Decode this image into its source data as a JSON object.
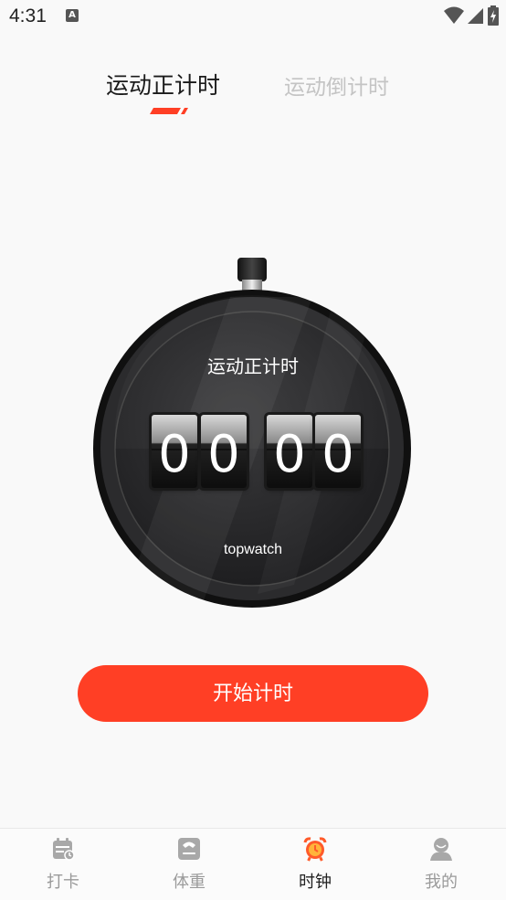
{
  "status_bar": {
    "time": "4:31",
    "badge": "A"
  },
  "tabs": [
    {
      "label": "运动正计时",
      "active": true
    },
    {
      "label": "运动倒计时",
      "active": false
    }
  ],
  "accent_color": "#ff3f25",
  "watch": {
    "title": "运动正计时",
    "digits": [
      "0",
      "0",
      "0",
      "0"
    ],
    "brand": "topwatch"
  },
  "start_button": {
    "label": "开始计时"
  },
  "bottom_nav": [
    {
      "label": "打卡",
      "icon": "calendar-icon",
      "active": false
    },
    {
      "label": "体重",
      "icon": "scale-icon",
      "active": false
    },
    {
      "label": "时钟",
      "icon": "alarm-clock-icon",
      "active": true
    },
    {
      "label": "我的",
      "icon": "user-icon",
      "active": false
    }
  ]
}
